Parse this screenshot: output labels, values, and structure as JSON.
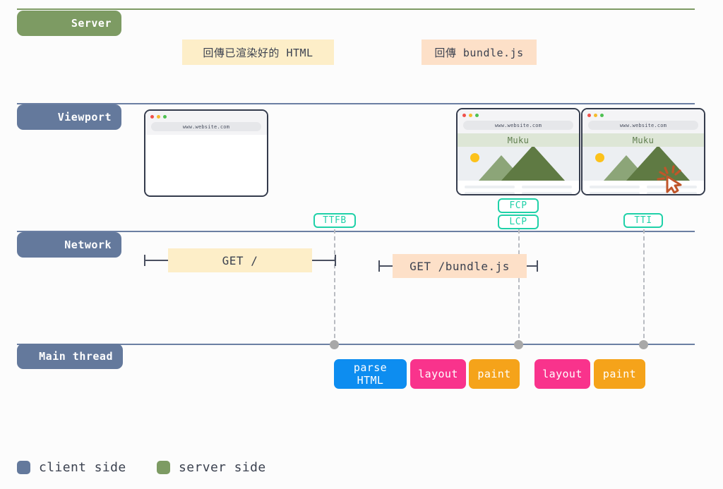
{
  "colors": {
    "server_green": "#7d9b63",
    "client_blue": "#64799c",
    "metric_teal": "#1fd1a8",
    "chip_yellow": "#fdeec8",
    "chip_orange": "#fde0c8",
    "parse_blue": "#0d8df0",
    "layout_pink": "#f9338c",
    "paint_orange": "#f5a31a",
    "node_gray": "#a8a8a8",
    "background": "#fcfcfc"
  },
  "rows": [
    {
      "key": "server",
      "label": "Server",
      "side": "server"
    },
    {
      "key": "viewport",
      "label": "Viewport",
      "side": "client"
    },
    {
      "key": "network",
      "label": "Network",
      "side": "client"
    },
    {
      "key": "main_thread",
      "label": "Main thread",
      "side": "client"
    }
  ],
  "server_messages": [
    {
      "key": "html_response",
      "text": "回傳已渲染好的 HTML",
      "tone": "yellow"
    },
    {
      "key": "bundle_response",
      "text": "回傳 bundle.js",
      "tone": "orange"
    }
  ],
  "browsers": [
    {
      "key": "blank",
      "url": "www.website.com",
      "rendered": false,
      "brand": "",
      "cursor": false
    },
    {
      "key": "fcp-lcp",
      "url": "www.website.com",
      "rendered": true,
      "brand": "Muku",
      "cursor": false
    },
    {
      "key": "interactive",
      "url": "www.website.com",
      "rendered": true,
      "brand": "Muku",
      "cursor": true
    }
  ],
  "metrics": [
    {
      "key": "ttfb",
      "label": "TTFB"
    },
    {
      "key": "fcp",
      "label": "FCP"
    },
    {
      "key": "lcp",
      "label": "LCP"
    },
    {
      "key": "tti",
      "label": "TTI"
    }
  ],
  "network_requests": [
    {
      "key": "get_root",
      "label": "GET /",
      "tone": "yellow"
    },
    {
      "key": "get_bundle",
      "label": "GET /bundle.js",
      "tone": "orange"
    }
  ],
  "main_thread_tasks": [
    {
      "key": "parse_html",
      "line1": "parse",
      "line2": "HTML",
      "tone": "parse"
    },
    {
      "key": "layout_1",
      "line1": "layout",
      "line2": "",
      "tone": "layout"
    },
    {
      "key": "paint_1",
      "line1": "paint",
      "line2": "",
      "tone": "paint"
    },
    {
      "key": "layout_2",
      "line1": "layout",
      "line2": "",
      "tone": "layout"
    },
    {
      "key": "paint_2",
      "line1": "paint",
      "line2": "",
      "tone": "paint"
    }
  ],
  "legend": [
    {
      "key": "client_side",
      "label": "client side",
      "color": "#64799c"
    },
    {
      "key": "server_side",
      "label": "server side",
      "color": "#7d9b63"
    }
  ]
}
